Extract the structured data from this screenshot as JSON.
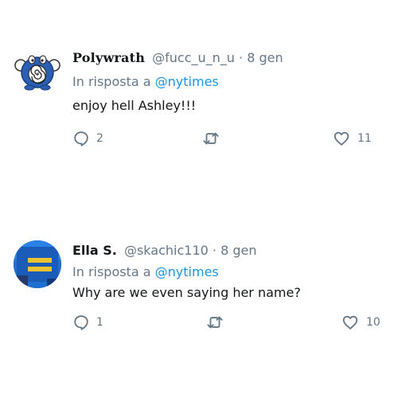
{
  "tweets": [
    {
      "display_name": "Polywrath",
      "handle": "@fucc_u_n_u",
      "separator": "·",
      "date": "8 gen",
      "reply_prefix": "In risposta a",
      "reply_to": "@nytimes",
      "text": "enjoy hell Ashley!!!",
      "replies": "2",
      "likes": "11",
      "icons": [
        "reply-icon",
        "retweet-icon",
        "heart-icon"
      ]
    },
    {
      "display_name": "Ella S.",
      "handle": "@skachic110",
      "separator": "·",
      "date": "8 gen",
      "reply_prefix": "In risposta a",
      "reply_to": "@nytimes",
      "text": "Why are we even saying her name?",
      "replies": "1",
      "likes": "10",
      "icons": [
        "reply-icon",
        "retweet-icon",
        "heart-icon"
      ]
    }
  ],
  "colors": {
    "text": "#14171a",
    "secondary": "#657786",
    "link": "#1b95e0"
  }
}
